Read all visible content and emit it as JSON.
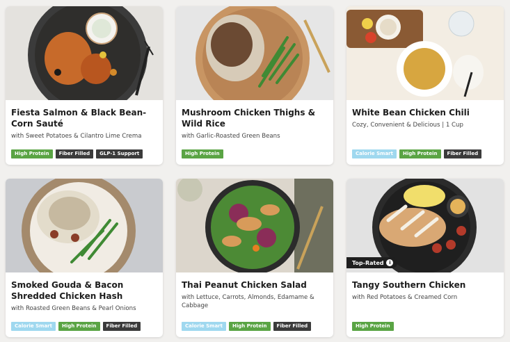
{
  "cards": [
    {
      "title": "Fiesta Salmon & Black Bean-Corn Sauté",
      "subtitle": "with Sweet Potatoes & Cilantro Lime Crema",
      "tags": [
        "High Protein",
        "Fiber Filled",
        "GLP-1 Support"
      ]
    },
    {
      "title": "Mushroom Chicken Thighs & Wild Rice",
      "subtitle": "with Garlic-Roasted Green Beans",
      "tags": [
        "High Protein"
      ]
    },
    {
      "title": "White Bean Chicken Chili",
      "subtitle": "Cozy, Convenient & Delicious | 1 Cup",
      "tags": [
        "Calorie Smart",
        "High Protein",
        "Fiber Filled"
      ]
    },
    {
      "title": "Smoked Gouda & Bacon Shredded Chicken Hash",
      "subtitle": "with Roasted Green Beans & Pearl Onions",
      "tags": [
        "Calorie Smart",
        "High Protein",
        "Fiber Filled"
      ]
    },
    {
      "title": "Thai Peanut Chicken Salad",
      "subtitle": "with Lettuce, Carrots, Almonds, Edamame & Cabbage",
      "tags": [
        "Calorie Smart",
        "High Protein",
        "Fiber Filled"
      ]
    },
    {
      "title": "Tangy Southern Chicken",
      "subtitle": "with Red Potatoes & Creamed Corn",
      "tags": [
        "High Protein"
      ],
      "badge": "Top-Rated",
      "badge_icon": "info-icon"
    }
  ],
  "tag_colors": {
    "High Protein": "#5aa444",
    "Fiber Filled": "#3b3b3b",
    "GLP-1 Support": "#3b3b3b",
    "Calorie Smart": "#9fd8ef"
  }
}
